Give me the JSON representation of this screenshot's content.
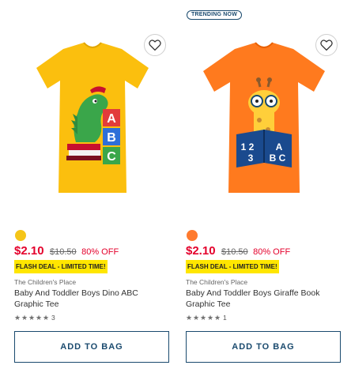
{
  "products": [
    {
      "trending": "",
      "color_swatch": "#f5c518",
      "shirt_color": "#fbbf0e",
      "price": "$2.10",
      "original_price": "$10.50",
      "discount": "80% OFF",
      "flash_deal": "FLASH DEAL - LIMITED TIME!",
      "brand": "The Children's Place",
      "name": "Baby And Toddler Boys Dino ABC Graphic Tee",
      "rating_stars": 5,
      "review_count": "3",
      "add_to_bag": "ADD TO BAG",
      "graphic": "dinosaur-abc-blocks",
      "graphic_text": "ABC"
    },
    {
      "trending": "TRENDING NOW",
      "color_swatch": "#ff7a2e",
      "shirt_color": "#ff7a1e",
      "price": "$2.10",
      "original_price": "$10.50",
      "discount": "80% OFF",
      "flash_deal": "FLASH DEAL - LIMITED TIME!",
      "brand": "The Children's Place",
      "name": "Baby And Toddler Boys Giraffe Book Graphic Tee",
      "rating_stars": 5,
      "review_count": "1",
      "add_to_bag": "ADD TO BAG",
      "graphic": "giraffe-reading-book",
      "graphic_text": "1 2 3 A B C"
    }
  ],
  "icons": {
    "wishlist": "heart-icon",
    "rating": "star-icon"
  }
}
